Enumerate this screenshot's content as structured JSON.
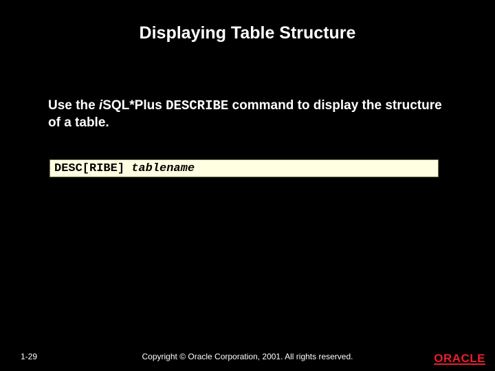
{
  "title": "Displaying Table Structure",
  "body": {
    "pre": "Use the ",
    "isqlplus_i": "i",
    "isqlplus_rest": "SQL*Plus ",
    "describe_cmd": "DESCRIBE",
    "post": " command to display the structure of a table."
  },
  "code": {
    "keyword": "DESC[RIBE] ",
    "arg": "tablename"
  },
  "footer": {
    "page": "1-29",
    "copyright": "Copyright © Oracle Corporation, 2001. All rights reserved.",
    "logo_text": "ORACLE"
  }
}
